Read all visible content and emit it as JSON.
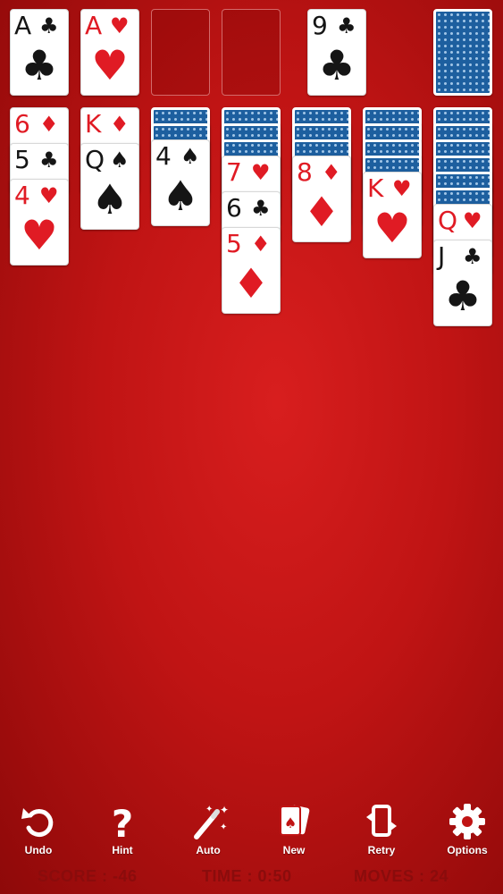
{
  "foundations": [
    {
      "rank": "A",
      "suit": "♣",
      "color": "black"
    },
    {
      "rank": "A",
      "suit": "♥",
      "color": "red"
    },
    null,
    null
  ],
  "waste": {
    "rank": "9",
    "suit": "♣",
    "color": "black"
  },
  "stock": {
    "face_down": true
  },
  "tableau": [
    {
      "face_down": 0,
      "cards": [
        {
          "rank": "6",
          "suit": "♦",
          "color": "red"
        },
        {
          "rank": "5",
          "suit": "♣",
          "color": "black"
        },
        {
          "rank": "4",
          "suit": "♥",
          "color": "red"
        }
      ]
    },
    {
      "face_down": 0,
      "cards": [
        {
          "rank": "K",
          "suit": "♦",
          "color": "red"
        },
        {
          "rank": "Q",
          "suit": "♠",
          "color": "black"
        }
      ]
    },
    {
      "face_down": 2,
      "cards": [
        {
          "rank": "4",
          "suit": "♠",
          "color": "black"
        }
      ]
    },
    {
      "face_down": 3,
      "cards": [
        {
          "rank": "7",
          "suit": "♥",
          "color": "red"
        },
        {
          "rank": "6",
          "suit": "♣",
          "color": "black"
        },
        {
          "rank": "5",
          "suit": "♦",
          "color": "red"
        }
      ]
    },
    {
      "face_down": 3,
      "cards": [
        {
          "rank": "8",
          "suit": "♦",
          "color": "red"
        }
      ]
    },
    {
      "face_down": 4,
      "cards": [
        {
          "rank": "K",
          "suit": "♥",
          "color": "red"
        }
      ]
    },
    {
      "face_down": 6,
      "cards": [
        {
          "rank": "Q",
          "suit": "♥",
          "color": "red"
        },
        {
          "rank": "J",
          "suit": "♣",
          "color": "black"
        }
      ]
    }
  ],
  "toolbar": {
    "undo": "Undo",
    "hint": "Hint",
    "auto": "Auto",
    "new": "New",
    "retry": "Retry",
    "options": "Options"
  },
  "status": {
    "score_label": "SCORE",
    "score_value": "-46",
    "time_label": "TIME",
    "time_value": "0:50",
    "moves_label": "MOVES",
    "moves_value": "24"
  },
  "colors": {
    "felt": "#c01414",
    "red_suit": "#e01b24",
    "card_back": "#1d5f9f",
    "status_text": "#8a0c0c"
  }
}
